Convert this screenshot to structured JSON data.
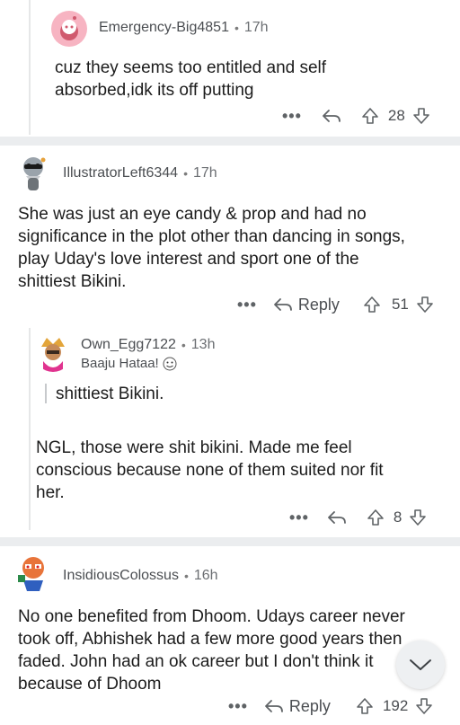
{
  "comments": [
    {
      "username": "Emergency-Big4851",
      "age": "17h",
      "body_lines": [
        "cuz they seems too entitled and self",
        "absorbed,idk its off putting"
      ],
      "votes": "28"
    },
    {
      "username": "IllustratorLeft6344",
      "age": "17h",
      "body_lines": [
        "She was just an eye candy & prop and had no",
        "significance in the plot other than dancing in songs,",
        "play Uday's love interest and sport one of the",
        "shittiest Bikini."
      ],
      "reply_label": "Reply",
      "votes": "51"
    },
    {
      "username": "Own_Egg7122",
      "age": "13h",
      "flair": "Baaju Hataa!",
      "quote": "shittiest Bikini.",
      "body_lines": [
        "NGL, those were shit bikini. Made me feel",
        "conscious because none of them suited nor fit",
        "her."
      ],
      "votes": "8"
    },
    {
      "username": "InsidiousColossus",
      "age": "16h",
      "body_lines": [
        "No one benefited from Dhoom. Udays career never",
        "took off, Abhishek had a few more good years then",
        "faded. John had an ok career but I don't think it",
        "because of Dhoom"
      ],
      "reply_label": "Reply",
      "votes": "192"
    }
  ],
  "ui": {
    "separator": "•",
    "more": "•••"
  },
  "colors": {
    "separator_band": "#ebedef",
    "avatar_pink": "#f5a9b8"
  }
}
